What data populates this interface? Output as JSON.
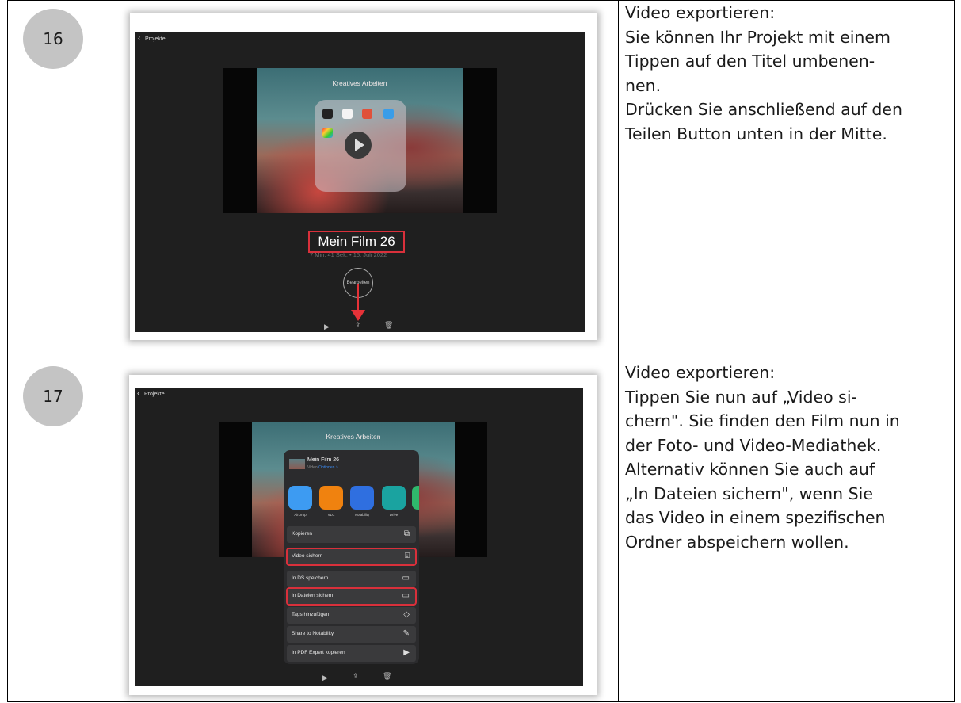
{
  "rows": [
    {
      "number": "16",
      "description_lines": [
        "Video exportieren:",
        "Sie können Ihr Projekt mit einem",
        "Tippen auf den Titel umbenen-",
        "nen.",
        "Drücken Sie anschließend auf den",
        "Teilen Button unten in der Mitte."
      ],
      "screen": {
        "back_label": "Projekte",
        "video_title": "Kreatives Arbeiten",
        "project_title": "Mein Film 26",
        "project_meta": "7 Min. 41 Sek. • 15. Juli 2022",
        "edit_label": "Bearbeiten"
      }
    },
    {
      "number": "17",
      "description_lines": [
        "Video exportieren:",
        "Tippen Sie nun auf „Video si-",
        "chern\". Sie finden den Film nun in",
        "der Foto- und Video-Mediathek.",
        "Alternativ können Sie auch auf",
        "„In Dateien sichern\", wenn Sie",
        "das Video in einem spezifischen",
        "Ordner abspeichern wollen."
      ],
      "screen": {
        "back_label": "Projekte",
        "video_title": "Kreatives Arbeiten",
        "share_title": "Mein Film 26",
        "share_kind": "Video",
        "share_options": "Optionen >",
        "apps": [
          {
            "label": "AirDrop",
            "color": "#3d9bf2"
          },
          {
            "label": "VLC",
            "color": "#f0820f"
          },
          {
            "label": "Notability",
            "color": "#2f6fe0"
          },
          {
            "label": "Drive",
            "color": "#1aa3a0"
          }
        ],
        "actions": [
          {
            "label": "Kopieren",
            "icon": "copy-icon",
            "glyph": "⧉",
            "highlighted": false
          },
          {
            "label": "Video sichern",
            "icon": "save-to-photos-icon",
            "glyph": "⍗",
            "highlighted": true
          },
          {
            "label": "In DS speichern",
            "icon": "folder-icon",
            "glyph": "▭",
            "highlighted": false
          },
          {
            "label": "In Dateien sichern",
            "icon": "folder-icon",
            "glyph": "▭",
            "highlighted": true
          },
          {
            "label": "Tags hinzufügen",
            "icon": "tag-icon",
            "glyph": "◇",
            "highlighted": false
          },
          {
            "label": "Share to Notability",
            "icon": "pencil-icon",
            "glyph": "✎",
            "highlighted": false
          },
          {
            "label": "In PDF Expert kopieren",
            "icon": "pdf-expert-icon",
            "glyph": "▶",
            "highlighted": false
          }
        ]
      }
    }
  ],
  "accent_color": "#d9303b"
}
